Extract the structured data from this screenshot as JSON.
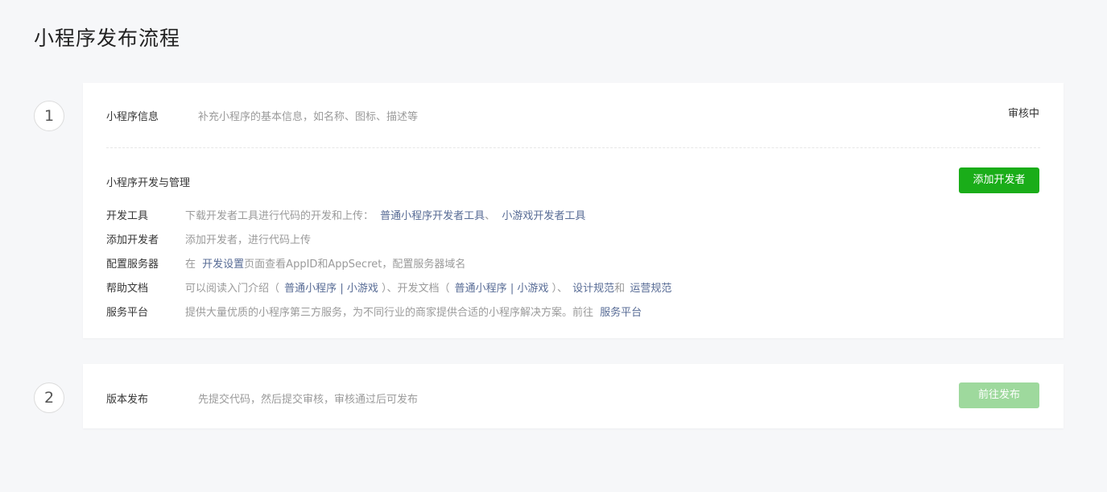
{
  "page": {
    "title": "小程序发布流程"
  },
  "steps": [
    {
      "number": "1"
    },
    {
      "number": "2"
    }
  ],
  "info": {
    "label": "小程序信息",
    "desc": "补充小程序的基本信息，如名称、图标、描述等",
    "status": "审核中"
  },
  "dev": {
    "title": "小程序开发与管理",
    "add_button": "添加开发者",
    "rows": {
      "tools": {
        "label": "开发工具",
        "text": "下载开发者工具进行代码的开发和上传：",
        "link1": "普通小程序开发者工具",
        "sep1": "、",
        "link2": "小游戏开发者工具"
      },
      "developers": {
        "label": "添加开发者",
        "text": "添加开发者，进行代码上传"
      },
      "server": {
        "label": "配置服务器",
        "prefix": "在",
        "link": "开发设置",
        "text": "页面查看AppID和AppSecret，配置服务器域名"
      },
      "docs": {
        "label": "帮助文档",
        "text1": "可以阅读入门介绍（",
        "link1": "普通小程序",
        "bar1": "|",
        "link2": "小游戏",
        "text2": "）、开发文档（",
        "link3": "普通小程序",
        "bar2": "|",
        "link4": "小游戏",
        "text3": "）、",
        "link5": "设计规范",
        "text4": "和",
        "link6": "运营规范"
      },
      "platform": {
        "label": "服务平台",
        "text": "提供大量优质的小程序第三方服务，为不同行业的商家提供合适的小程序解决方案。前往",
        "link": "服务平台"
      }
    }
  },
  "release": {
    "label": "版本发布",
    "desc": "先提交代码，然后提交审核，审核通过后可发布",
    "button": "前往发布"
  },
  "colors": {
    "primary": "#1aad19",
    "primary_disabled": "#9ed99d",
    "link": "#576b95",
    "muted": "#9a9a9a",
    "background": "#f6f7f9"
  }
}
